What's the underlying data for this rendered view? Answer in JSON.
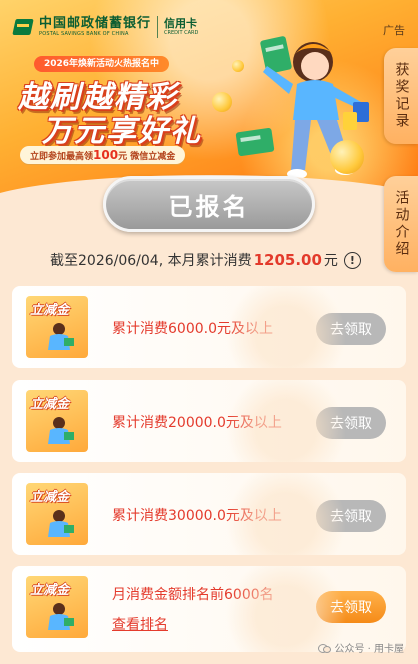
{
  "banner": {
    "brand_cn": "中国邮政储蓄银行",
    "brand_en": "POSTAL SAVINGS BANK OF CHINA",
    "card_cn": "信用卡",
    "card_en": "CREDIT CARD",
    "ad_label": "广告",
    "hot_pill": "2026年焕新活动火热报名中",
    "headline_1": "越刷越精彩",
    "headline_2": "万元享好礼",
    "cta_prefix": "立即参加最高领",
    "cta_amount": "100",
    "cta_suffix": "元 微信立减金"
  },
  "side_tabs": {
    "records": "获奖记录",
    "intro": "活动介绍"
  },
  "main": {
    "signed_label": "已报名",
    "stats_prefix": "截至2026/06/04, 本月累计消费",
    "stats_amount": "1205.00",
    "stats_unit": "元",
    "info_icon": "!"
  },
  "rewards": [
    {
      "thumb_title": "立减金",
      "label": "累计消费6000.0元及以上",
      "button": "去领取",
      "state": "disabled"
    },
    {
      "thumb_title": "立减金",
      "label": "累计消费20000.0元及以上",
      "button": "去领取",
      "state": "disabled"
    },
    {
      "thumb_title": "立减金",
      "label": "累计消费30000.0元及以上",
      "button": "去领取",
      "state": "disabled"
    },
    {
      "thumb_title": "立减金",
      "label": "月消费金额排名前6000名",
      "link": "查看排名",
      "button": "去领取",
      "state": "active"
    }
  ],
  "watermark": {
    "text": "公众号 · 用卡屋"
  },
  "colors": {
    "accent_red": "#e43b2d",
    "claim_disabled": "#b8b8b8",
    "claim_active": "#f58b18",
    "brand_green": "#0b5d32"
  },
  "icons": [
    "postal-bank-logo-icon",
    "info-icon",
    "wechat-icon"
  ]
}
